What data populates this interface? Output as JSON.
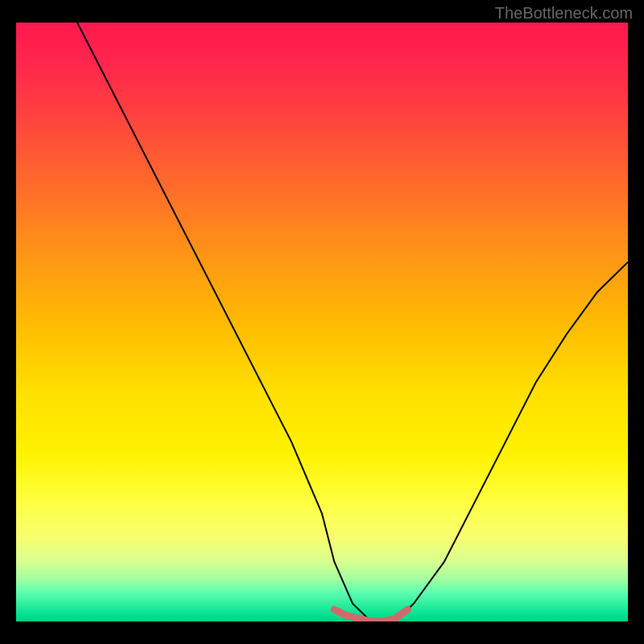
{
  "watermark": "TheBottleneck.com",
  "chart_data": {
    "type": "line",
    "title": "",
    "xlabel": "",
    "ylabel": "",
    "xlim": [
      0,
      100
    ],
    "ylim": [
      0,
      100
    ],
    "series": [
      {
        "name": "bottleneck-curve",
        "color": "#000000",
        "x": [
          10,
          15,
          20,
          25,
          30,
          35,
          40,
          45,
          50,
          52,
          55,
          58,
          60,
          62,
          65,
          70,
          75,
          80,
          85,
          90,
          95,
          100
        ],
        "y": [
          100,
          90,
          80,
          70,
          60,
          50,
          40,
          30,
          18,
          10,
          3,
          0,
          0,
          0,
          3,
          10,
          20,
          30,
          40,
          48,
          55,
          60
        ]
      },
      {
        "name": "bottleneck-highlight",
        "color": "#d87070",
        "x": [
          52,
          54,
          56,
          58,
          60,
          62,
          64
        ],
        "y": [
          2,
          1,
          0.5,
          0,
          0,
          0.5,
          2
        ]
      }
    ],
    "gradient_stops": [
      {
        "pos": 0,
        "color": "#ff1850"
      },
      {
        "pos": 50,
        "color": "#ffc000"
      },
      {
        "pos": 80,
        "color": "#ffff40"
      },
      {
        "pos": 100,
        "color": "#00d080"
      }
    ]
  }
}
